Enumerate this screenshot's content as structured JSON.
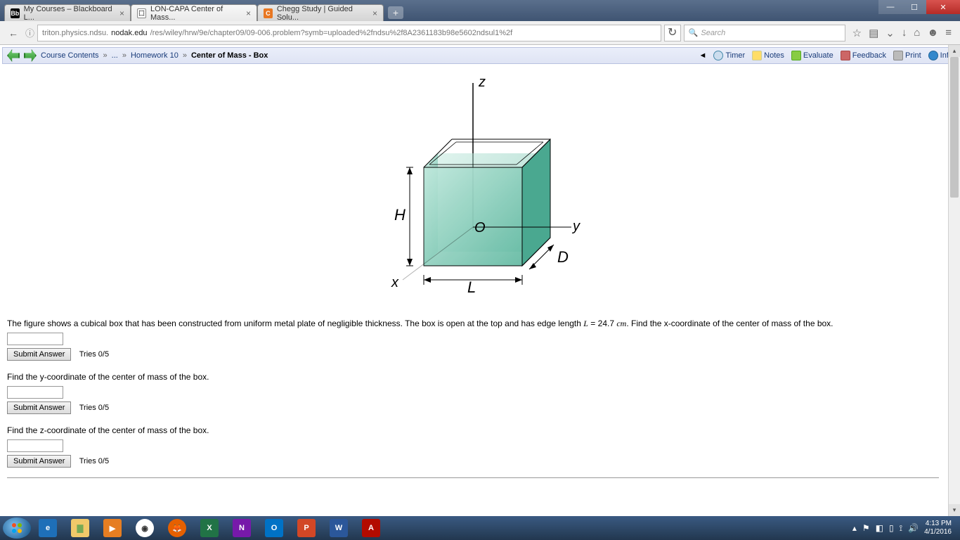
{
  "tabs": [
    {
      "label": "My Courses – Blackboard L...",
      "favicon": "Bb",
      "favbg": "#000",
      "favcolor": "#fff"
    },
    {
      "label": "LON-CAPA Center of Mass...",
      "favicon": "⬚",
      "favbg": "#fff",
      "favcolor": "#000"
    },
    {
      "label": "Chegg Study | Guided Solu...",
      "favicon": "C",
      "favbg": "#e87722",
      "favcolor": "#fff"
    }
  ],
  "url": {
    "prefix": "triton.physics.ndsu.",
    "domain": "nodak.edu",
    "path": "/res/wiley/hrw/9e/chapter09/09-006.problem?symb=uploaded%2fndsu%2f8A2361183b98e5602ndsul1%2f"
  },
  "search_placeholder": "Search",
  "breadcrumb": {
    "course": "Course Contents",
    "dots": "...",
    "hw": "Homework 10",
    "title": "Center of Mass - Box"
  },
  "coursetools": {
    "timer": "Timer",
    "notes": "Notes",
    "evaluate": "Evaluate",
    "feedback": "Feedback",
    "print": "Print",
    "info": "Info"
  },
  "figure": {
    "z": "z",
    "y": "y",
    "x": "x",
    "O": "O",
    "H": "H",
    "L": "L",
    "D": "D"
  },
  "problem": {
    "p1a": "The figure shows a cubical box that has been constructed from uniform metal plate of negligible thickness. The box is open at the top and has edge length ",
    "var": "L",
    "eq": " = 24.7 ",
    "unit": "cm",
    "p1b": ". Find the x-coordinate of the center of mass of the box.",
    "p2": "Find the y-coordinate of the center of mass of the box.",
    "p3": "Find the z-coordinate of the center of mass of the box."
  },
  "submit_label": "Submit Answer",
  "tries_label": "Tries 0/5",
  "clock": {
    "time": "4:13 PM",
    "date": "4/1/2016"
  }
}
